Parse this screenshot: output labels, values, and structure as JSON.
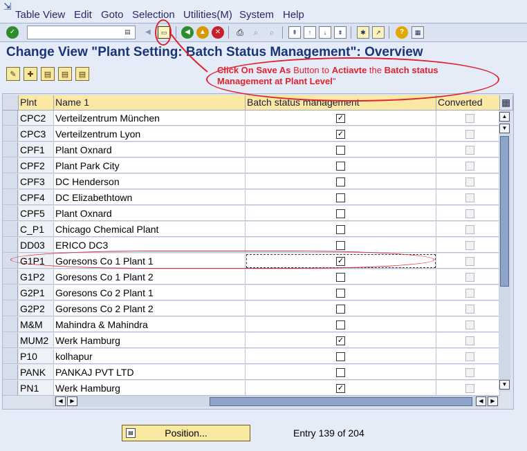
{
  "menu": {
    "glyph": "⇲",
    "items": [
      "Table View",
      "Edit",
      "Goto",
      "Selection",
      "Utilities(M)",
      "System",
      "Help"
    ]
  },
  "toolbar": {
    "command_field": "",
    "icons": [
      "enter-icon",
      "save-icon",
      "back-icon",
      "exit-icon",
      "cancel-icon",
      "print-icon",
      "find-icon",
      "find-next-icon",
      "first-page-icon",
      "previous-page-icon",
      "next-page-icon",
      "last-page-icon",
      "create-session-icon",
      "shortcut-icon",
      "help-icon",
      "customize-layout-icon"
    ]
  },
  "title": "Change View \"Plant Setting: Batch Status Management\": Overview",
  "annotation": {
    "part1": "Click On Save As",
    "part2": " Button to ",
    "part3": "Actiavte",
    "part4": " the ",
    "part5": "Batch status Management at Plant Level",
    "part6": "\""
  },
  "table": {
    "columns": [
      "Plnt",
      "Name 1",
      "Batch status management",
      "Converted"
    ],
    "rows": [
      {
        "plnt": "CPC2",
        "name": "Verteilzentrum München",
        "batch": true
      },
      {
        "plnt": "CPC3",
        "name": "Verteilzentrum Lyon",
        "batch": true
      },
      {
        "plnt": "CPF1",
        "name": "Plant Oxnard",
        "batch": false
      },
      {
        "plnt": "CPF2",
        "name": "Plant Park City",
        "batch": false
      },
      {
        "plnt": "CPF3",
        "name": "DC Henderson",
        "batch": false
      },
      {
        "plnt": "CPF4",
        "name": "DC Elizabethtown",
        "batch": false
      },
      {
        "plnt": "CPF5",
        "name": "Plant Oxnard",
        "batch": false
      },
      {
        "plnt": "C_P1",
        "name": "Chicago Chemical Plant",
        "batch": false
      },
      {
        "plnt": "DD03",
        "name": "ERICO DC3",
        "batch": false
      },
      {
        "plnt": "G1P1",
        "name": "Goresons Co 1 Plant 1",
        "batch": true
      },
      {
        "plnt": "G1P2",
        "name": "Goresons Co 1 Plant 2",
        "batch": false
      },
      {
        "plnt": "G2P1",
        "name": "Goresons Co 2 Plant 1",
        "batch": false
      },
      {
        "plnt": "G2P2",
        "name": "Goresons Co 2 Plant 2",
        "batch": false
      },
      {
        "plnt": "M&M",
        "name": "Mahindra & Mahindra",
        "batch": false
      },
      {
        "plnt": "MUM2",
        "name": "Werk Hamburg",
        "batch": true
      },
      {
        "plnt": "P10",
        "name": "kolhapur",
        "batch": false
      },
      {
        "plnt": "PANK",
        "name": "PANKAJ PVT LTD",
        "batch": false
      },
      {
        "plnt": "PN1",
        "name": "Werk Hamburg",
        "batch": true
      }
    ]
  },
  "footer": {
    "position_label": "Position...",
    "entry_info": "Entry 139 of 204"
  },
  "colors": {
    "accent": "#19357a",
    "annotation": "#e0212e",
    "header_bg": "#fbe8a2"
  }
}
